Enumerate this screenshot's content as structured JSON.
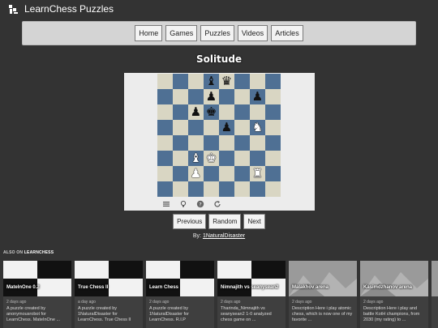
{
  "header": {
    "title": "LearnChess Puzzles",
    "logo_icon": "chess-pieces-icon"
  },
  "nav": {
    "items": [
      {
        "label": "Home"
      },
      {
        "label": "Games"
      },
      {
        "label": "Puzzles"
      },
      {
        "label": "Videos"
      },
      {
        "label": "Articles"
      }
    ]
  },
  "puzzle": {
    "title": "Solitude",
    "board": [
      [
        "",
        "",
        "",
        "bB",
        "bQ",
        "",
        "",
        ""
      ],
      [
        "",
        "",
        "",
        "bP",
        "",
        "",
        "bP",
        ""
      ],
      [
        "",
        "",
        "bP",
        "bK",
        "",
        "",
        "",
        ""
      ],
      [
        "",
        "",
        "",
        "",
        "bP",
        "",
        "wN",
        ""
      ],
      [
        "",
        "",
        "",
        "",
        "",
        "",
        "",
        ""
      ],
      [
        "",
        "",
        "wB",
        "wK",
        "",
        "",
        "",
        ""
      ],
      [
        "",
        "",
        "wP",
        "",
        "",
        "",
        "wR",
        ""
      ],
      [
        "",
        "",
        "",
        "",
        "",
        "",
        "",
        ""
      ]
    ],
    "light_color": "#d9d6c3",
    "dark_color": "#4f7094",
    "tools": [
      {
        "icon": "menu-icon"
      },
      {
        "icon": "lightbulb-icon"
      },
      {
        "icon": "help-icon"
      },
      {
        "icon": "refresh-icon"
      }
    ],
    "buttons": {
      "previous": "Previous",
      "random": "Random",
      "next": "Next"
    },
    "byline_prefix": "By:",
    "author": "1NaturalDisaster"
  },
  "also": {
    "prefix": "ALSO ON",
    "site": "LEARNCHESS"
  },
  "cards": [
    {
      "thumb": "chess",
      "title": "MateInOne 0.2",
      "date": "2 days ago",
      "desc": "A puzzle created by anonymousrobot for LearnChess. MateInOne ..."
    },
    {
      "thumb": "chess",
      "title": "True Chess II",
      "date": "a day ago",
      "desc": "A puzzle created by 1NaturalDisaster for LearnChess. True Chess II"
    },
    {
      "thumb": "chess",
      "title": "Learn Chess",
      "date": "2 days ago",
      "desc": "A puzzle created by 1NaturalDisaster for LearnChess. R.I.P"
    },
    {
      "thumb": "chess",
      "title": "Nimnajith vs seanysean2",
      "date": "2 days ago",
      "desc": "Tharinda_Nimnajith vs seanysean2 1-0 analyzed chess game on ..."
    },
    {
      "thumb": "mount",
      "title": "Malakhov arena",
      "date": "2 days ago",
      "desc": "Description Here i play atomic chess, which is now one of my favorite ..."
    },
    {
      "thumb": "mount",
      "title": "Kasimdzhanov arena",
      "date": "2 days ago",
      "desc": "Description Here i play and battle KotH champions, from 2030 (my rating) to ..."
    }
  ]
}
